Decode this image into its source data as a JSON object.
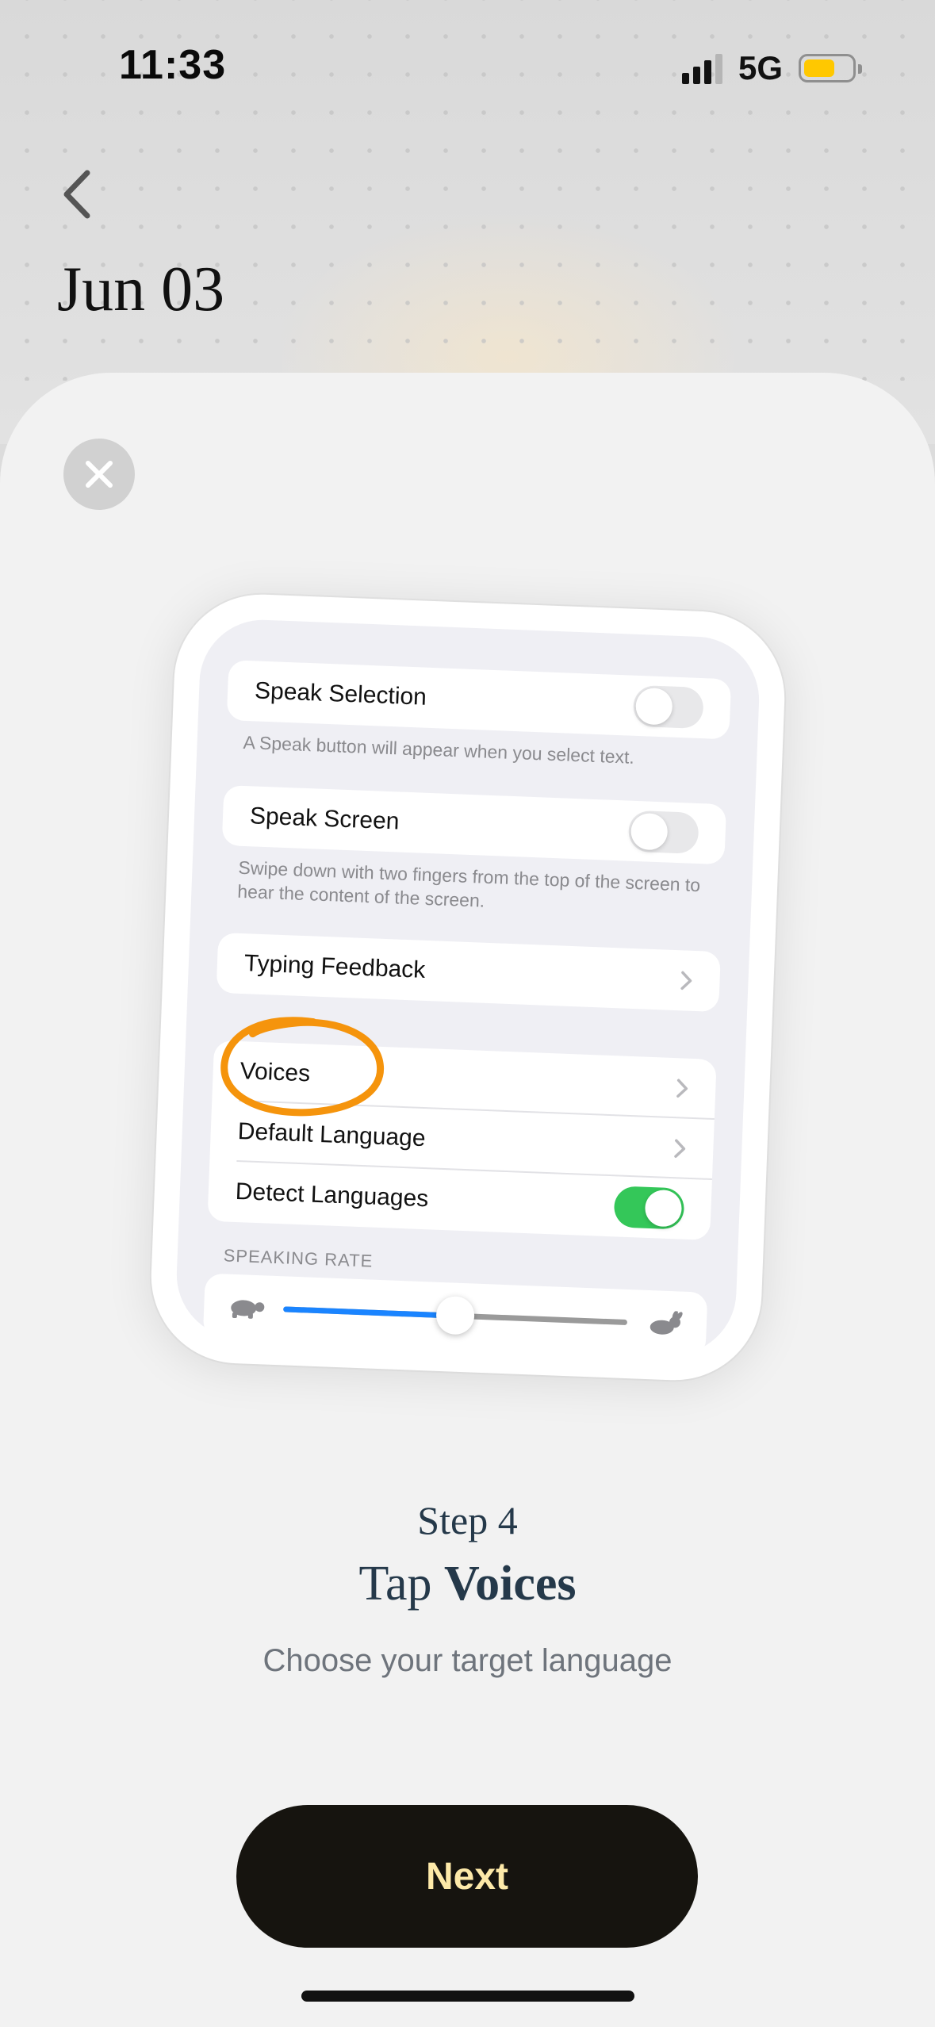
{
  "status_bar": {
    "time": "11:33",
    "network": "5G",
    "battery_color": "#ffc800"
  },
  "header": {
    "back_icon": "chevron-left-icon",
    "date": "Jun 03"
  },
  "sheet": {
    "close_icon": "close-icon",
    "illustration": {
      "speak_selection": {
        "label": "Speak Selection",
        "toggle_on": false,
        "footnote": "A Speak button will appear when you select text."
      },
      "speak_screen": {
        "label": "Speak Screen",
        "toggle_on": false,
        "footnote": "Swipe down with two fingers from the top of the screen to hear the content of the screen."
      },
      "typing_feedback": {
        "label": "Typing Feedback"
      },
      "voices": {
        "label": "Voices"
      },
      "default_language": {
        "label": "Default Language"
      },
      "detect_languages": {
        "label": "Detect Languages",
        "toggle_on": true
      },
      "speaking_rate": {
        "section_label": "SPEAKING RATE",
        "value_fraction": 0.5,
        "slow_icon": "turtle-icon",
        "fast_icon": "rabbit-icon"
      },
      "highlight_color": "#f5940c"
    },
    "step": {
      "label": "Step 4",
      "title_prefix": "Tap",
      "title_bold": "Voices",
      "subtitle": "Choose your target language"
    },
    "next_button": "Next"
  }
}
